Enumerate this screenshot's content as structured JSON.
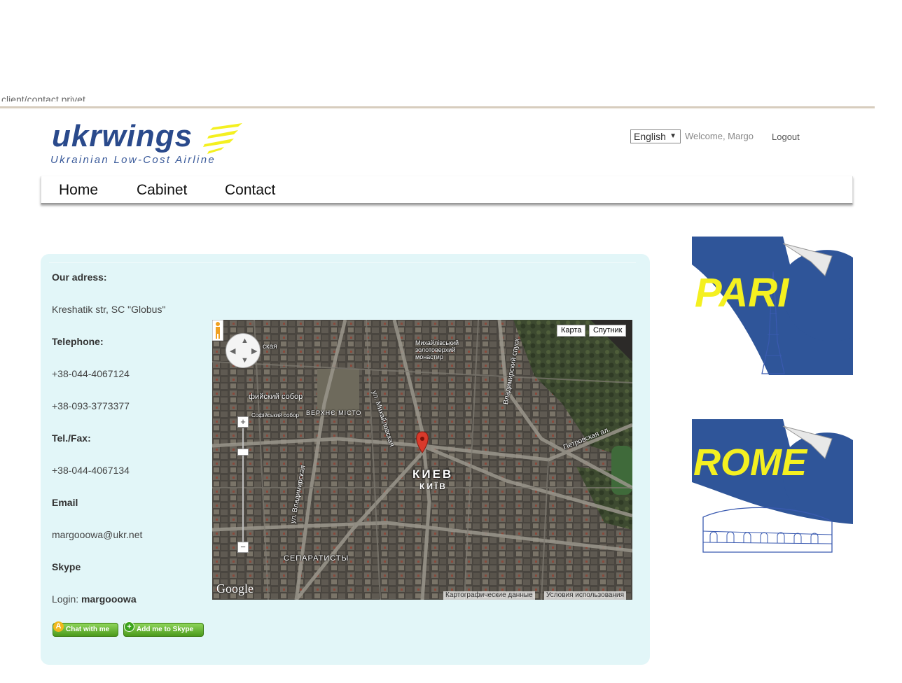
{
  "browser": {
    "url_fragment": "client/contact.privet"
  },
  "brand": {
    "name": "ukrwings",
    "tagline": "Ukrainian Low-Cost Airline"
  },
  "header": {
    "language": "English",
    "welcome": "Welcome, Margo",
    "logout": "Logout"
  },
  "nav": {
    "items": [
      {
        "label": "Home"
      },
      {
        "label": "Cabinet"
      },
      {
        "label": "Contact"
      }
    ]
  },
  "contact": {
    "address_label": "Our adress:",
    "address_value": "Kreshatik str, SC \"Globus\"",
    "telephone_label": "Telephone:",
    "phone1": "+38-044-4067124",
    "phone2": "+38-093-3773377",
    "fax_label": "Tel./Fax:",
    "fax_value": "+38-044-4067134",
    "email_label": "Email",
    "email_value": "margooowa@ukr.net",
    "skype_label": "Skype",
    "login_prefix": "Login:",
    "login_value": "margooowa",
    "chat_button": "Chat with me",
    "add_button": "Add me to Skype"
  },
  "map": {
    "type_map": "Карта",
    "type_satellite": "Спутник",
    "city_ru": "КИЕВ",
    "city_ua": "КИЇВ",
    "google": "Google",
    "footer_data": "Картографические данные",
    "footer_terms": "Условия использования",
    "labels": {
      "sofia1": "фийский собор",
      "sofia2": "Софійський собор",
      "upper_city": "ВЕРХНЄ МІСТО",
      "monastery": "Михайлівський золотоверхий монастир",
      "mykhailivska": "ул. Михайловская",
      "vladimir_descent": "Владимирский спуск",
      "petrovska": "Петровская ал.",
      "vladimirska": "ул. Владимирская",
      "separatists": "СЕПАРАТИСТЫ",
      "skaya": "ская"
    }
  },
  "ads": {
    "paris": "PARI",
    "rome": "ROME"
  },
  "colors": {
    "brand_blue": "#2a4a8c",
    "content_bg": "#e2f6f8",
    "skype_green": "#4b9a1c",
    "ad_yellow": "#f4f020",
    "ad_blue": "#2f5599"
  }
}
